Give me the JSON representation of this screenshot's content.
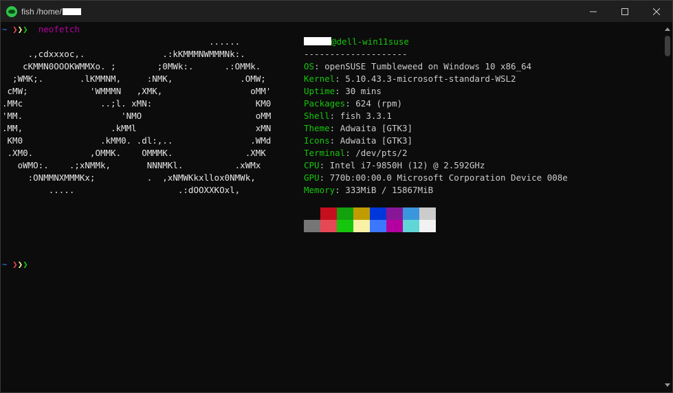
{
  "window": {
    "title_prefix": "fish /home/",
    "icon": "fish-shell-icon"
  },
  "controls": [
    "minimize-icon",
    "maximize-icon",
    "close-icon"
  ],
  "prompt": {
    "tilde": "~",
    "arrow1": "❯",
    "arrow2": "❯",
    "arrow3": "❯",
    "command": "neofetch"
  },
  "logo_lines": [
    "                                        ......",
    "     .,cdxxxoc,.               .:kKMMMNWMMMNk:.",
    "    cKMMN0OOOKWMMXo. ;        ;0MWk:.      .:OMMk.",
    "  ;WMK;.       .lKMMNM,     :NMK,             .OMW;",
    " cMW;            'WMMMN   ,XMK,                 oMM'",
    ".MMc               ..;l. xMN:                    KM0",
    "'MM.                   'NMO                      oMM",
    ".MM,                 .kMMl                       xMN",
    " KM0               .kMM0. .dl:,..               .WMd",
    " .XM0.           ,OMMK.    OMMMK.              .XMK",
    "   oWMO:.    .;xNMMk,       NNNMKl.          .xWMx",
    "     :ONMMNXMMMKx;          .  ,xNMWKkxllox0NMWk,",
    "         .....                    .:dOOXXKOxl,"
  ],
  "header": {
    "host": "@dell-win11suse",
    "separator": "--------------------"
  },
  "info": [
    {
      "key": "OS",
      "value": "openSUSE Tumbleweed on Windows 10 x86_64"
    },
    {
      "key": "Kernel",
      "value": "5.10.43.3-microsoft-standard-WSL2"
    },
    {
      "key": "Uptime",
      "value": "30 mins"
    },
    {
      "key": "Packages",
      "value": "624 (rpm)"
    },
    {
      "key": "Shell",
      "value": "fish 3.3.1"
    },
    {
      "key": "Theme",
      "value": "Adwaita [GTK3]"
    },
    {
      "key": "Icons",
      "value": "Adwaita [GTK3]"
    },
    {
      "key": "Terminal",
      "value": "/dev/pts/2"
    },
    {
      "key": "CPU",
      "value": "Intel i7-9850H (12) @ 2.592GHz"
    },
    {
      "key": "GPU",
      "value": "770b:00:00.0 Microsoft Corporation Device 008e"
    },
    {
      "key": "Memory",
      "value": "333MiB / 15867MiB"
    }
  ],
  "palette": {
    "row1": [
      "#0c0c0c",
      "#c50f1f",
      "#13a10e",
      "#c19c00",
      "#0037da",
      "#881798",
      "#3a96dd",
      "#cccccc"
    ],
    "row2": [
      "#767676",
      "#e74856",
      "#16c60c",
      "#f9f1a5",
      "#3b78ff",
      "#b4009e",
      "#61d6d6",
      "#f2f2f2"
    ]
  },
  "prompt2": {
    "tilde": "~",
    "arrow1": "❯",
    "arrow2": "❯",
    "arrow3": "❯"
  }
}
